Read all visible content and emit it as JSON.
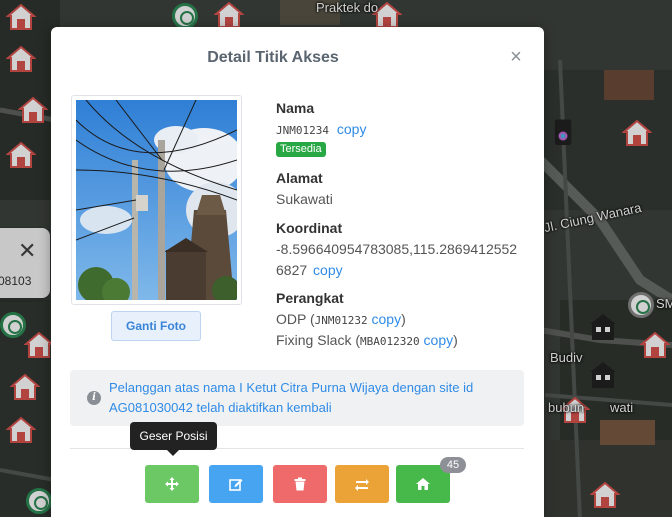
{
  "map": {
    "labels": {
      "street_main": "Jl. Ciung Wanara",
      "street_top": "Praktek do",
      "street_budiv": "Budiv",
      "street_bubun": "bubun",
      "street_wati": "wati",
      "poi_sm": "SM"
    },
    "mini_popup": {
      "close_glyph": "✕",
      "id_text": "08103"
    }
  },
  "modal": {
    "title": "Detail Titik Akses",
    "close_glyph": "×",
    "photo_button": "Ganti Foto",
    "nama": {
      "label": "Nama",
      "code": "JNM01234",
      "copy": "copy",
      "status": "Tersedia"
    },
    "alamat": {
      "label": "Alamat",
      "value": "Sukawati"
    },
    "koordinat": {
      "label": "Koordinat",
      "line1": "-8.596640954783085,115.2869412552",
      "line2": "6827",
      "copy": "copy"
    },
    "perangkat": {
      "label": "Perangkat",
      "odp_prefix": "ODP (",
      "odp_code": "JNM01232",
      "odp_copy": "copy",
      "odp_suffix": ")",
      "slack_prefix": "Fixing Slack (",
      "slack_code": "MBA012320",
      "slack_copy": "copy",
      "slack_suffix": ")"
    },
    "notice": {
      "icon": "i",
      "text": "Pelanggan atas nama I Ketut Citra Purna Wijaya dengan site id AG081030042 telah diaktifkan kembali"
    },
    "tooltip": "Geser Posisi",
    "actions": [
      {
        "name": "move",
        "color": "#6cc765",
        "icon": "move-icon"
      },
      {
        "name": "edit",
        "color": "#46a4f0",
        "icon": "edit-icon"
      },
      {
        "name": "delete",
        "color": "#ef6b6b",
        "icon": "trash-icon"
      },
      {
        "name": "swap",
        "color": "#eba236",
        "icon": "swap-icon"
      },
      {
        "name": "home",
        "color": "#47b84a",
        "icon": "home-icon"
      }
    ],
    "home_count": "45"
  },
  "colors": {
    "accent": "#2f8be6",
    "success": "#28a745",
    "title": "#5a6570"
  }
}
